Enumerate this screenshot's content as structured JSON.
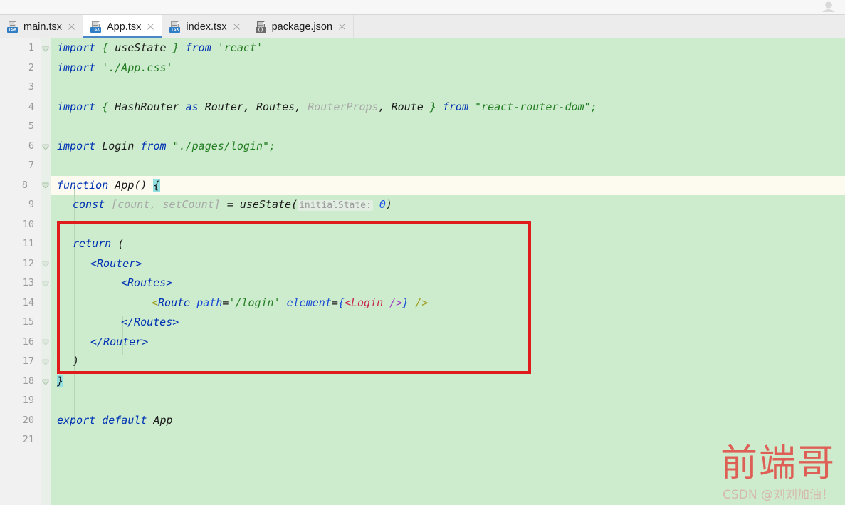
{
  "window": {
    "top_strip_icon": "user-avatar-icon"
  },
  "tabs": [
    {
      "label": "main.tsx",
      "icon": "tsx-file-icon",
      "badge": "TSX",
      "active": false,
      "close": "close-icon"
    },
    {
      "label": "App.tsx",
      "icon": "tsx-file-icon",
      "badge": "TSX",
      "active": true,
      "close": "close-icon"
    },
    {
      "label": "index.tsx",
      "icon": "tsx-file-icon",
      "badge": "TSX",
      "active": false,
      "close": "close-icon"
    },
    {
      "label": "package.json",
      "icon": "json-file-icon",
      "badge": "{ }",
      "active": false,
      "close": "close-icon"
    }
  ],
  "editor": {
    "language": "tsx",
    "caret_line": 8,
    "background_color": "#cdeccd",
    "caret_line_color": "#fdfbf0",
    "gutter_color": "#f1f1f1",
    "line_numbers": [
      "1",
      "2",
      "3",
      "4",
      "5",
      "6",
      "7",
      "8",
      "9",
      "10",
      "11",
      "12",
      "13",
      "14",
      "15",
      "16",
      "17",
      "18",
      "19",
      "20",
      "21"
    ],
    "fold_marker_lines": [
      1,
      6,
      8,
      18
    ],
    "lines": {
      "l1_import": "import",
      "l1_brace_open": " { ",
      "l1_usestate": "useState",
      "l1_brace_close": " } ",
      "l1_from": "from",
      "l1_module": " 'react'",
      "l2_import": "import",
      "l2_module": " './App.css'",
      "l4_import": "import",
      "l4_brace_open": " { ",
      "l4_hashrouter": "HashRouter",
      "l4_as": " as ",
      "l4_router": "Router",
      "l4_comma1": ", ",
      "l4_routes": "Routes",
      "l4_comma2": ", ",
      "l4_routerprops": "RouterProps",
      "l4_comma3": ", ",
      "l4_route": "Route",
      "l4_brace_close": " } ",
      "l4_from": "from",
      "l4_module": " \"react-router-dom\";",
      "l6_import": "import",
      "l6_login": " Login ",
      "l6_from": "from",
      "l6_module": " \"./pages/login\";",
      "l8_function": "function",
      "l8_name": " App",
      "l8_parens": "() ",
      "l8_brace": "{",
      "l9_const": "const",
      "l9_destructure": " [count, setCount]",
      "l9_eq": " = ",
      "l9_usestate": "useState",
      "l9_paren_open": "(",
      "l9_hint": "initialState:",
      "l9_zero": " 0",
      "l9_paren_close": ")",
      "l11_return": "return",
      "l11_paren": " (",
      "l12_router_open": "<Router>",
      "l13_routes_open": "<Routes>",
      "l14_lt": "<",
      "l14_tag": "Route",
      "l14_path_attr": " path",
      "l14_eq1": "=",
      "l14_path_val": "'/login'",
      "l14_element_attr": " element",
      "l14_eq2": "=",
      "l14_curly_open": "{",
      "l14_login": "<Login",
      "l14_selfclose1": " />",
      "l14_curly_close": "}",
      "l14_selfclose2": " />",
      "l15_routes_close": "</Routes>",
      "l16_router_close": "</Router>",
      "l17_paren_close": ")",
      "l18_brace": "}",
      "l20_export": "export default",
      "l20_app": " App"
    }
  },
  "annotation": {
    "highlight_box_color": "#e01b1b",
    "covers_lines": "11-17"
  },
  "watermark": {
    "main": "前端哥",
    "sub": "CSDN @刘刘加油！",
    "color": "#e0544c"
  }
}
